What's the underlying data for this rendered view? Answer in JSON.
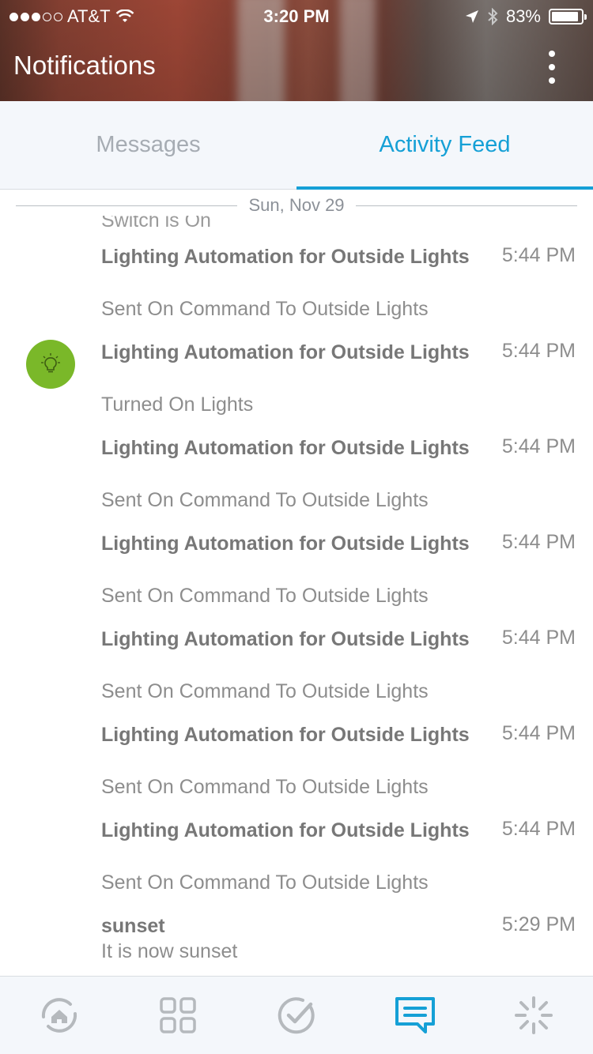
{
  "status_bar": {
    "carrier": "AT&T",
    "time": "3:20 PM",
    "battery": "83%",
    "signal_bars_filled": 3,
    "signal_bars_total": 5
  },
  "header": {
    "title": "Notifications"
  },
  "tabs": [
    {
      "label": "Messages",
      "active": false
    },
    {
      "label": "Activity Feed",
      "active": true
    }
  ],
  "feed": {
    "date_header": "Sun, Nov 29",
    "clipped_text": "Switch is On",
    "items": [
      {
        "title": "Lighting Automation for Outside Lights",
        "description": "Sent On Command To Outside Lights",
        "time": "5:44 PM",
        "icon": null
      },
      {
        "title": "Lighting Automation for Outside Lights",
        "description": "Turned On Lights",
        "time": "5:44 PM",
        "icon": "lightbulb-icon"
      },
      {
        "title": "Lighting Automation for Outside Lights",
        "description": "Sent On Command To Outside Lights",
        "time": "5:44 PM",
        "icon": null
      },
      {
        "title": "Lighting Automation for Outside Lights",
        "description": "Sent On Command To Outside Lights",
        "time": "5:44 PM",
        "icon": null
      },
      {
        "title": "Lighting Automation for Outside Lights",
        "description": "Sent On Command To Outside Lights",
        "time": "5:44 PM",
        "icon": null
      },
      {
        "title": "Lighting Automation for Outside Lights",
        "description": "Sent On Command To Outside Lights",
        "time": "5:44 PM",
        "icon": null
      },
      {
        "title": "Lighting Automation for Outside Lights",
        "description": "Sent On Command To Outside Lights",
        "time": "5:44 PM",
        "icon": null
      },
      {
        "title": "sunset",
        "description": "It is now sunset",
        "time": "5:29 PM",
        "icon": null
      }
    ]
  },
  "bottom_nav": [
    {
      "name": "home-icon",
      "active": false
    },
    {
      "name": "things-grid-icon",
      "active": false
    },
    {
      "name": "routines-check-icon",
      "active": false
    },
    {
      "name": "notifications-icon",
      "active": true
    },
    {
      "name": "marketplace-icon",
      "active": false
    }
  ],
  "colors": {
    "accent": "#15a0d6",
    "inactive_tab": "#a6acb3",
    "bulb_green": "#7ab829",
    "nav_inactive": "#b5b9bd"
  }
}
